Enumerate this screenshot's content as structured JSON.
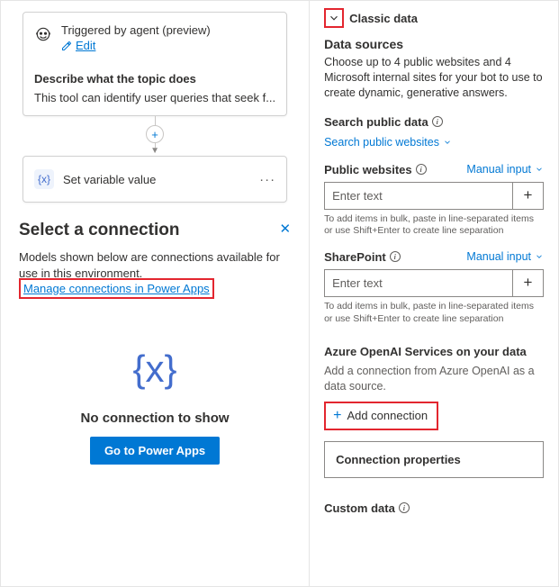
{
  "flow": {
    "trigger_title": "Triggered by agent (preview)",
    "edit_label": "Edit",
    "describe_label": "Describe what the topic does",
    "describe_text": "This tool can identify user queries that seek f...",
    "var_label": "Set variable value"
  },
  "panel": {
    "title": "Select a connection",
    "description": "Models shown below are connections available for use in this environment.",
    "manage_link": "Manage connections in Power Apps",
    "icon_text": "{x}",
    "empty_title": "No connection to show",
    "cta_label": "Go to Power Apps"
  },
  "right": {
    "classic_title": "Classic data",
    "data_sources_title": "Data sources",
    "data_sources_body": "Choose up to 4 public websites and 4 Microsoft internal sites for your bot to use to create dynamic, generative answers.",
    "search_label": "Search public data",
    "search_link": "Search public websites",
    "public_label": "Public websites",
    "manual_label": "Manual input",
    "input_placeholder": "Enter text",
    "bulk_hint": "To add items in bulk, paste in line-separated items or use Shift+Enter to create line separation",
    "sharepoint_label": "SharePoint",
    "azure_title": "Azure OpenAI Services on your data",
    "azure_body": "Add a connection from Azure OpenAI as a data source.",
    "add_connection_label": "Add connection",
    "conn_props_label": "Connection properties",
    "custom_label": "Custom data"
  }
}
